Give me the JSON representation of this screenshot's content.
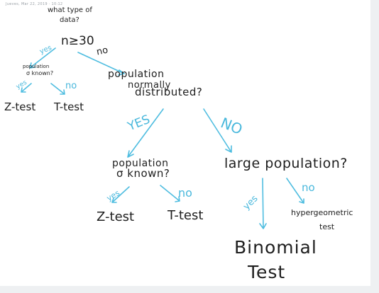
{
  "header": {
    "meta": "Jueves, Mar 22, 2019 · 10:12"
  },
  "nodes": {
    "root_question": [
      "what type of",
      "data?"
    ],
    "sample_size": "n≥30",
    "small_sigma_question": [
      "population",
      "σ known?"
    ],
    "small_z_test": "Z-test",
    "small_t_test": "T-test",
    "normal_question": [
      "population",
      "normally",
      "distributed?"
    ],
    "large_sigma_question": [
      "population",
      "σ known?"
    ],
    "large_z_test": "Z-test",
    "large_t_test": "T-test",
    "large_population_question": "large population?",
    "hypergeometric_test": [
      "hypergeometric",
      "test"
    ],
    "binomial_test": [
      "Binomial",
      "Test"
    ]
  },
  "edges": {
    "yes": "yes",
    "no": "no",
    "yes_upper": "YES",
    "no_upper": "NO"
  },
  "colors": {
    "ink": "#1e1e1e",
    "arrow": "#4fbde0",
    "background": "#ffffff",
    "frame": "#eef0f2"
  }
}
